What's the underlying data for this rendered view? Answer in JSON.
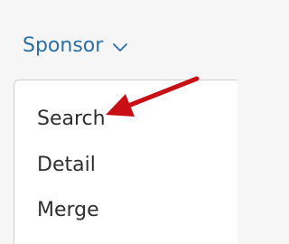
{
  "menu": {
    "title": "Sponsor",
    "trigger_icon": "chevron-down-icon",
    "accent_color": "#2b6fa8",
    "items": [
      {
        "label": "Search"
      },
      {
        "label": "Detail"
      },
      {
        "label": "Merge"
      }
    ]
  },
  "annotation": {
    "icon": "arrow-pointer-icon",
    "color": "#c80f14"
  }
}
